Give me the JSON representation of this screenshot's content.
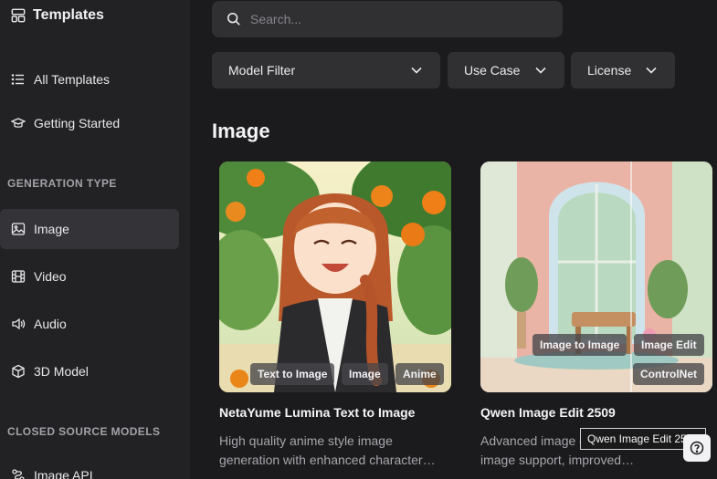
{
  "sidebar": {
    "brand": {
      "title": "Templates",
      "icon": "templates-icon"
    },
    "items": [
      {
        "label": "All Templates",
        "icon": "list-icon"
      },
      {
        "label": "Getting Started",
        "icon": "graduation-cap-icon"
      }
    ],
    "generation_type": {
      "label": "GENERATION TYPE",
      "items": [
        {
          "label": "Image",
          "icon": "image-icon",
          "active": true
        },
        {
          "label": "Video",
          "icon": "film-icon"
        },
        {
          "label": "Audio",
          "icon": "speaker-icon"
        },
        {
          "label": "3D Model",
          "icon": "cube-icon"
        }
      ]
    },
    "closed_source": {
      "label": "CLOSED SOURCE MODELS",
      "items": [
        {
          "label": "Image API",
          "icon": "api-icon"
        }
      ]
    }
  },
  "search": {
    "placeholder": "Search..."
  },
  "filters": [
    {
      "label": "Model Filter"
    },
    {
      "label": "Use Case"
    },
    {
      "label": "License"
    }
  ],
  "section": {
    "title": "Image"
  },
  "cards": [
    {
      "title": "NetaYume Lumina Text to Image",
      "desc_lines": [
        "High quality anime style image",
        "generation with enhanced character…"
      ],
      "tags": [
        "Text to Image",
        "Image",
        "Anime"
      ]
    },
    {
      "title": "Qwen Image Edit 2509",
      "desc_lines": [
        "Advanced image editing with multi-",
        "image support, improved…"
      ],
      "tags": [
        "Image to Image",
        "Image Edit",
        "ControlNet"
      ]
    }
  ],
  "tooltip": {
    "text": "Qwen Image Edit 2509"
  },
  "colors": {
    "background": "#1b1b1d",
    "sidebar": "#222225",
    "active_item": "#343438",
    "control": "#303033"
  }
}
